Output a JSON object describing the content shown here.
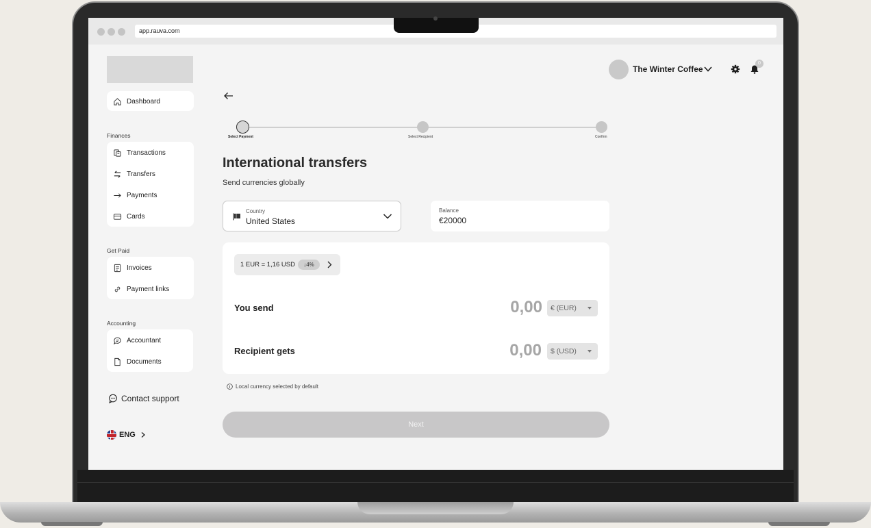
{
  "browser": {
    "url": "app.rauva.com"
  },
  "header": {
    "company_name": "The Winter Coffee",
    "notification_count": "0"
  },
  "sidebar": {
    "dashboard_label": "Dashboard",
    "finances": {
      "title": "Finances",
      "items": [
        {
          "label": "Transactions",
          "icon": "transactions-icon"
        },
        {
          "label": "Transfers",
          "icon": "transfers-icon"
        },
        {
          "label": "Payments",
          "icon": "arrow-right-icon"
        },
        {
          "label": "Cards",
          "icon": "card-icon"
        }
      ]
    },
    "get_paid": {
      "title": "Get Paid",
      "items": [
        {
          "label": "Invoices",
          "icon": "invoice-icon"
        },
        {
          "label": "Payment links",
          "icon": "link-icon"
        }
      ]
    },
    "accounting": {
      "title": "Accounting",
      "items": [
        {
          "label": "Accountant",
          "icon": "chat-icon"
        },
        {
          "label": "Documents",
          "icon": "document-icon"
        }
      ]
    },
    "contact_support": "Contact support",
    "language": "ENG"
  },
  "stepper": {
    "steps": [
      {
        "label": "Select Payment",
        "state": "active"
      },
      {
        "label": "Select Recipient",
        "state": "pending"
      },
      {
        "label": "Confirm",
        "state": "pending"
      }
    ]
  },
  "page": {
    "title": "International transfers",
    "subtitle": "Send currencies globally"
  },
  "country": {
    "label": "Country",
    "value": "United States"
  },
  "balance": {
    "label": "Balance",
    "value": "€20000"
  },
  "exchange": {
    "rate_text": "1 EUR = 1,16 USD",
    "rate_change": "↓4%",
    "send": {
      "label": "You send",
      "amount": "0,00",
      "currency": "€ (EUR)"
    },
    "receive": {
      "label": "Recipient gets",
      "amount": "0,00",
      "currency": "$ (USD)"
    }
  },
  "hint": "Local currency selected by default",
  "next_button": "Next",
  "colors": {
    "background": "#f4f4f4",
    "button_disabled": "#c8c7c8",
    "panel": "#ffffff"
  }
}
